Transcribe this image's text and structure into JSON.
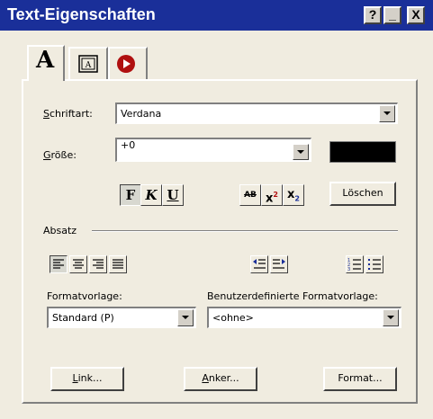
{
  "window": {
    "title": "Text-Eigenschaften",
    "help": "?",
    "minimize": "_",
    "close": "X"
  },
  "tabs": [
    {
      "icon": "text-format-icon",
      "label": "A"
    },
    {
      "icon": "text-frame-icon",
      "label": ""
    },
    {
      "icon": "record-icon",
      "label": ""
    }
  ],
  "font": {
    "label_mnemonic": "S",
    "label_rest": "chriftart:",
    "value": "Verdana"
  },
  "size": {
    "label_mnemonic": "G",
    "label_rest": "röße:",
    "value": "+0",
    "color": "#000000"
  },
  "style_buttons": {
    "bold": "F",
    "italic": "K",
    "underline": "U",
    "strike": "AB",
    "sup": "x",
    "sub": "x",
    "sup_mark": "2",
    "sub_mark": "2"
  },
  "clear_button": "Löschen",
  "paragraph": {
    "label": "Absatz"
  },
  "template": {
    "label": "Formatvorlage:",
    "value": "Standard (P)"
  },
  "custom_template": {
    "label": "Benutzerdefinierte Formatvorlage:",
    "value": "<ohne>"
  },
  "buttons": {
    "link_mnemonic": "L",
    "link_rest": "ink...",
    "anchor_mnemonic": "A",
    "anchor_rest": "nker...",
    "format": "Format..."
  },
  "colors": {
    "titlebar": "#1a2f99",
    "face": "#f0ece0",
    "record": "#b01010"
  }
}
